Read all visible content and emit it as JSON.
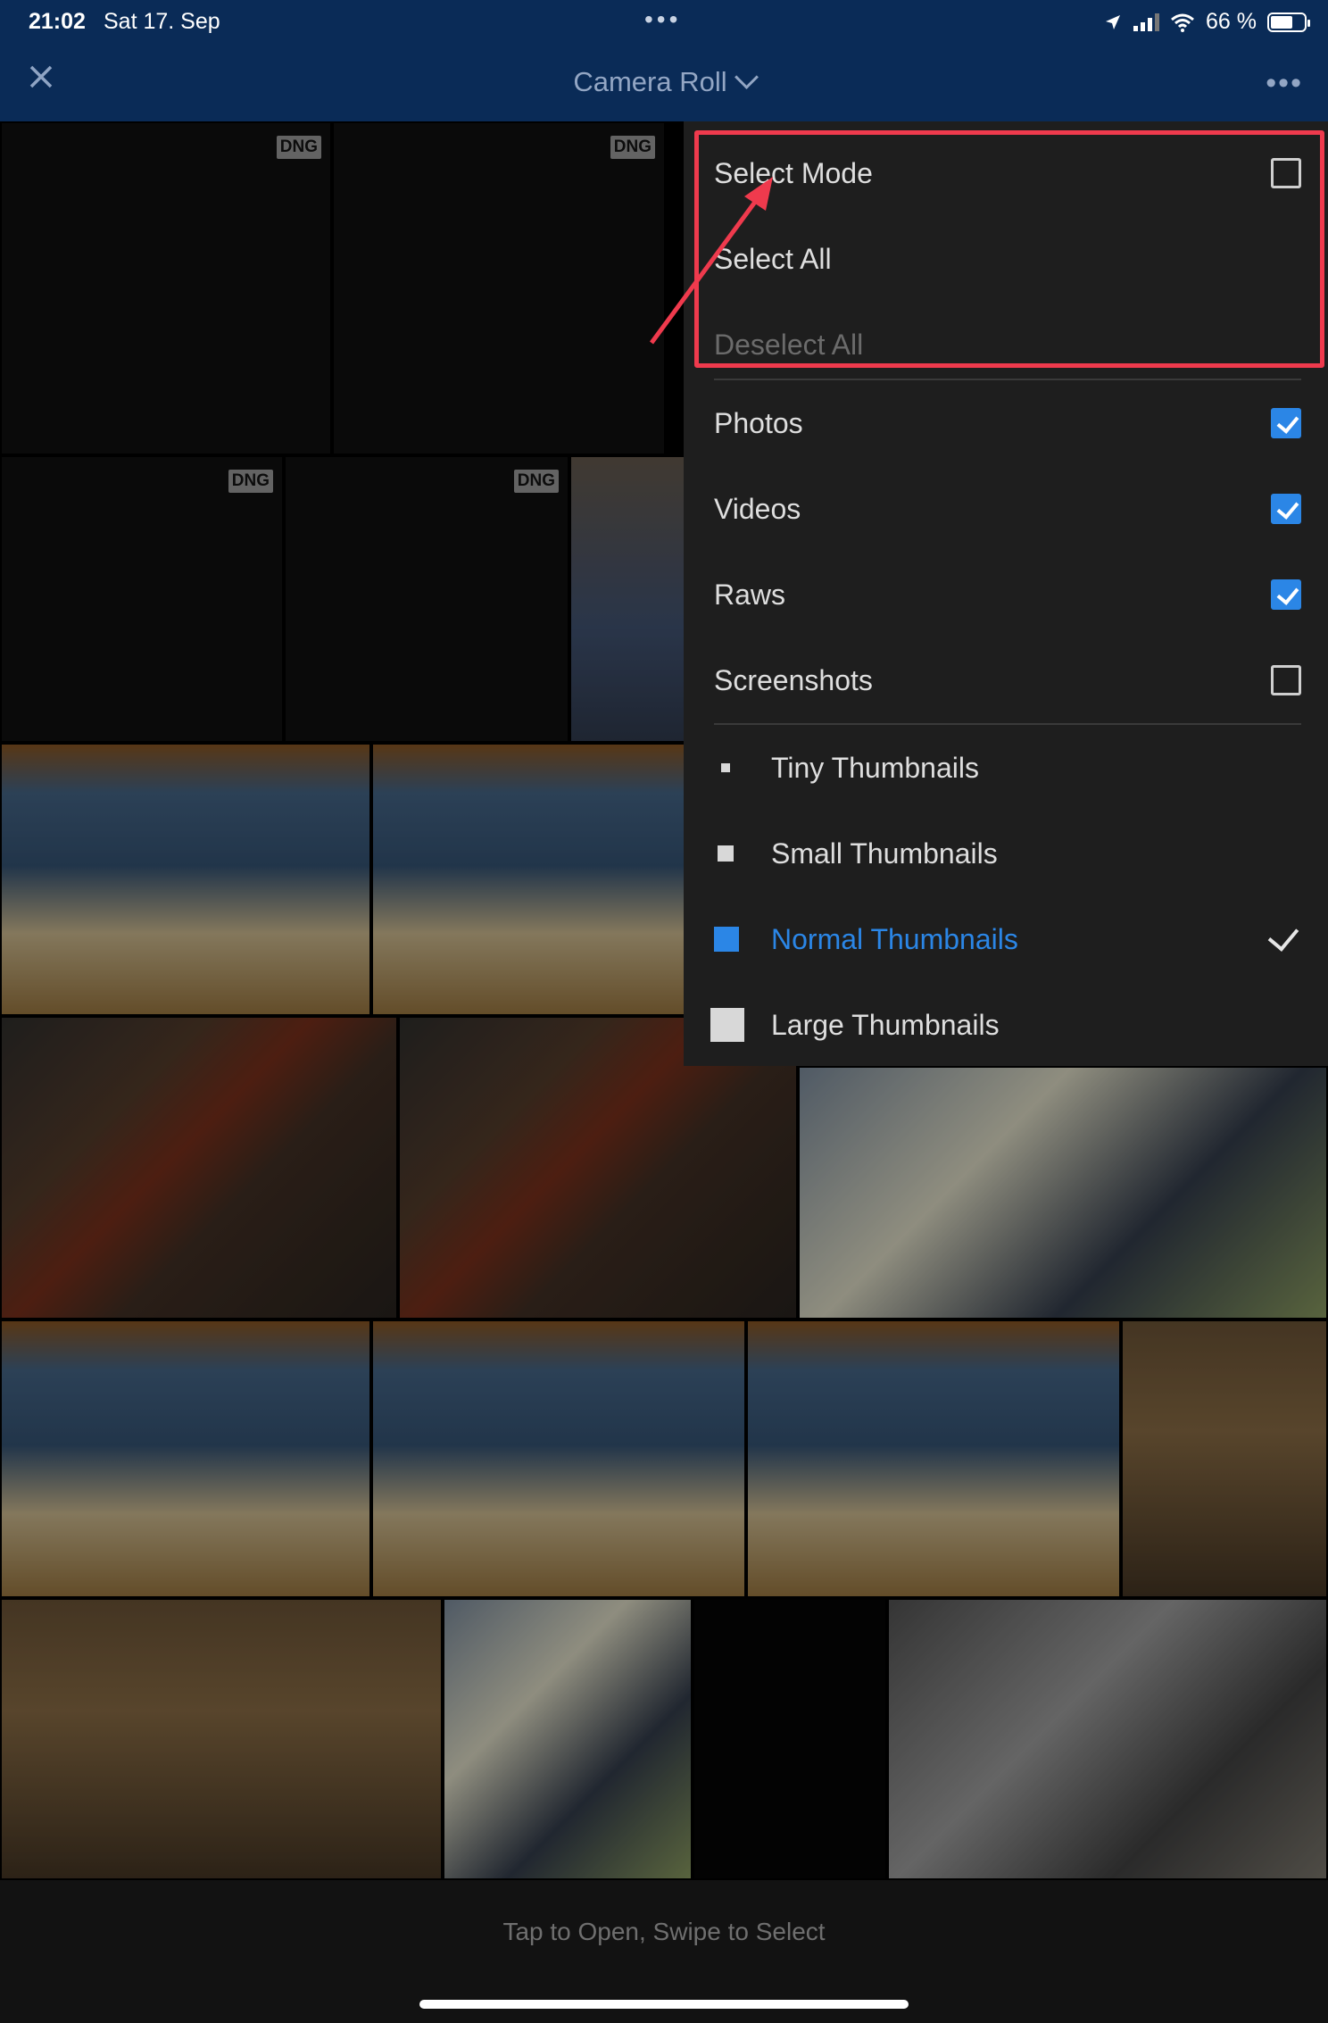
{
  "status_bar": {
    "time": "21:02",
    "date": "Sat 17. Sep",
    "battery": "66 %",
    "battery_level": 0.66
  },
  "nav": {
    "title": "Camera Roll",
    "close_icon": "close-icon",
    "more_icon": "more-icon"
  },
  "badge": {
    "dng": "DNG"
  },
  "menu": {
    "select_mode": "Select Mode",
    "select_all": "Select All",
    "deselect_all": "Deselect All",
    "filters": [
      {
        "label": "Photos",
        "checked": true
      },
      {
        "label": "Videos",
        "checked": true
      },
      {
        "label": "Raws",
        "checked": true
      },
      {
        "label": "Screenshots",
        "checked": false
      }
    ],
    "thumbnails": [
      {
        "label": "Tiny Thumbnails",
        "selected": false
      },
      {
        "label": "Small Thumbnails",
        "selected": false
      },
      {
        "label": "Normal Thumbnails",
        "selected": true
      },
      {
        "label": "Large Thumbnails",
        "selected": false
      }
    ]
  },
  "footer": {
    "hint": "Tap to Open, Swipe to Select"
  },
  "colors": {
    "nav_bg": "#0a2b57",
    "accent": "#2b86e6",
    "highlight": "#ef3a4d",
    "menu_bg": "#1e1e1e"
  }
}
